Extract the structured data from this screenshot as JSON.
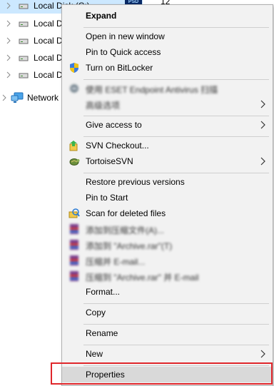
{
  "nav": {
    "items": [
      {
        "label": "Local Disk (C:)",
        "selected": true
      },
      {
        "label": "Local D"
      },
      {
        "label": "Local D"
      },
      {
        "label": "Local D"
      },
      {
        "label": "Local D"
      },
      {
        "label": "Network"
      }
    ],
    "peek_thumb_label": "PSD",
    "peek_text": "12"
  },
  "menu": {
    "expand": "Expand",
    "open_new_window": "Open in new window",
    "pin_quick_access": "Pin to Quick access",
    "turn_on_bitlocker": "Turn on BitLocker",
    "eset_scan": "使用 ESET Endpoint Antivirus 扫描",
    "advanced_options": "高级选项",
    "give_access_to": "Give access to",
    "svn_checkout": "SVN Checkout...",
    "tortoise_svn": "TortoiseSVN",
    "restore_previous": "Restore previous versions",
    "pin_to_start": "Pin to Start",
    "scan_deleted": "Scan for deleted files",
    "add_to_archive": "添加到压缩文件(A)...",
    "add_to_archive_named": "添加到 \"Archive.rar\"(T)",
    "compress_email": "压缩并 E-mail...",
    "compress_named_email": "压缩到 \"Archive.rar\" 并 E-mail",
    "format": "Format...",
    "copy": "Copy",
    "rename": "Rename",
    "new": "New",
    "properties": "Properties"
  },
  "colors": {
    "menu_bg": "#f2f2f2",
    "hover_bg": "#d9d9d9",
    "selected_bg": "#cce8ff",
    "highlight_box": "#e0262b"
  }
}
